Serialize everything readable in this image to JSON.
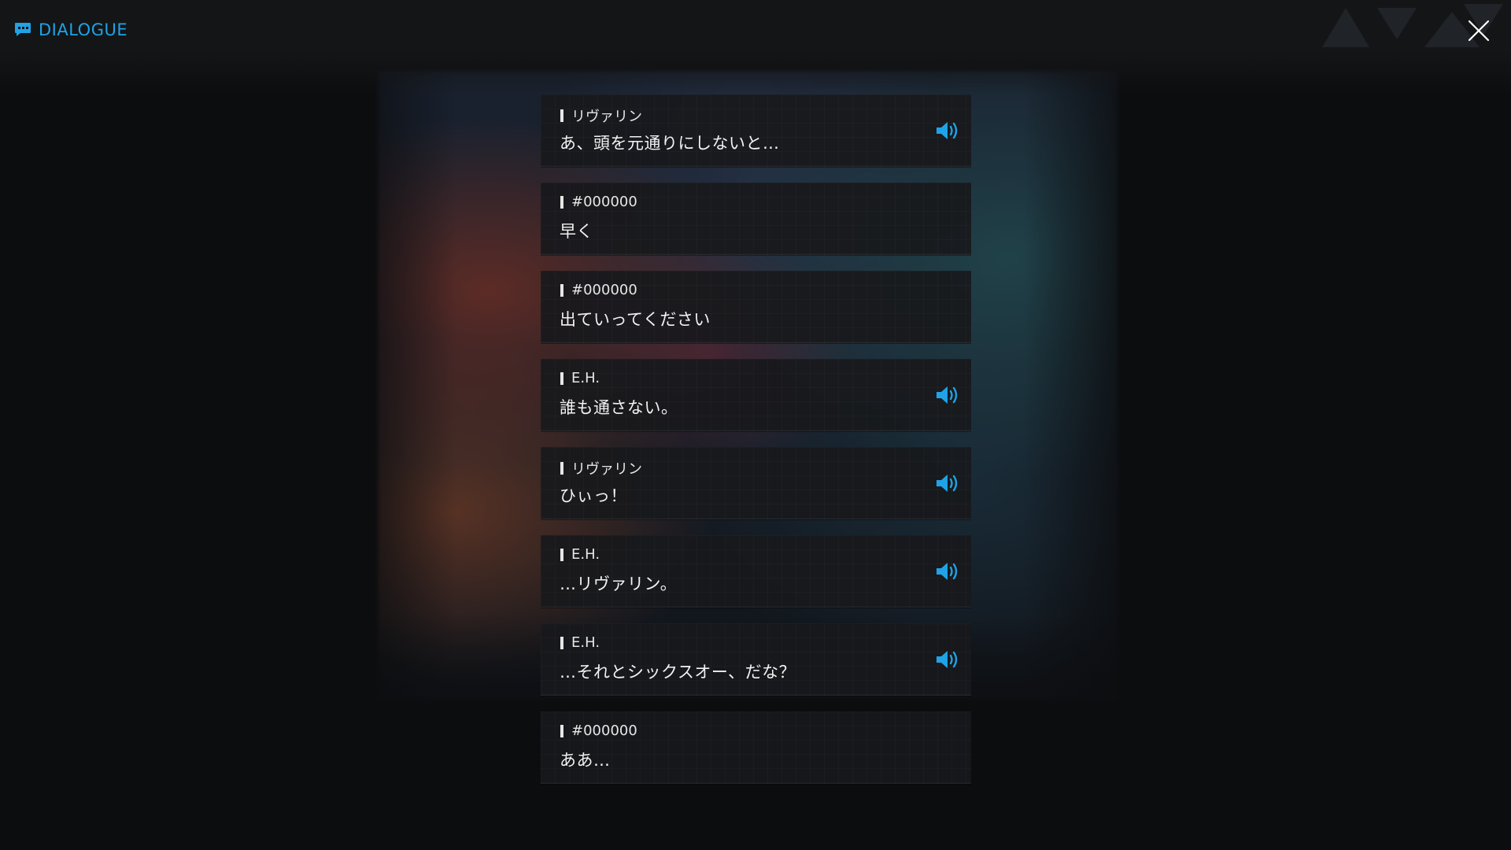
{
  "header": {
    "title": "DIALOGUE"
  },
  "colors": {
    "accent": "#1fa3e6",
    "entry_bg": "#18191c",
    "text": "#f2f2f2"
  },
  "icons": {
    "header": "chat-bubble-icon",
    "close": "close-icon",
    "voice": "speaker-icon"
  },
  "entries": [
    {
      "speaker": "リヴァリン",
      "text": "あ、頭を元通りにしないと…",
      "has_voice": true
    },
    {
      "speaker": "#000000",
      "text": "早く",
      "has_voice": false
    },
    {
      "speaker": "#000000",
      "text": "出ていってください",
      "has_voice": false
    },
    {
      "speaker": "E.H.",
      "text": "誰も通さない。",
      "has_voice": true
    },
    {
      "speaker": "リヴァリン",
      "text": "ひぃっ！",
      "has_voice": true
    },
    {
      "speaker": "E.H.",
      "text": "…リヴァリン。",
      "has_voice": true
    },
    {
      "speaker": "E.H.",
      "text": "…それとシックスオー、だな？",
      "has_voice": true
    },
    {
      "speaker": "#000000",
      "text": "ああ…",
      "has_voice": false
    }
  ]
}
